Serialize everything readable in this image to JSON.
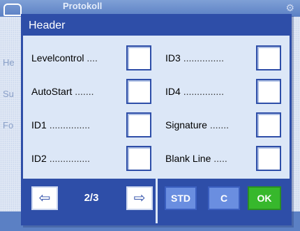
{
  "background": {
    "title": "Protokoll",
    "items": [
      "He",
      "Su",
      "Fo"
    ]
  },
  "dialog": {
    "title": "Header",
    "rows_left": [
      {
        "label": "Levelcontrol",
        "dots": "....",
        "checked": false
      },
      {
        "label": "AutoStart",
        "dots": ".......",
        "checked": false
      },
      {
        "label": "ID1",
        "dots": "...............",
        "checked": false
      },
      {
        "label": "ID2",
        "dots": "...............",
        "checked": false
      }
    ],
    "rows_right": [
      {
        "label": "ID3",
        "dots": "...............",
        "checked": false
      },
      {
        "label": "ID4",
        "dots": "...............",
        "checked": false
      },
      {
        "label": "Signature",
        "dots": ".......",
        "checked": false
      },
      {
        "label": "Blank Line",
        "dots": ".....",
        "checked": false
      }
    ]
  },
  "footer": {
    "prev_icon": "left-arrow-icon",
    "next_icon": "right-arrow-icon",
    "page": "2/3",
    "std_label": "STD",
    "c_label": "C",
    "ok_label": "OK"
  },
  "colors": {
    "dialog_blue": "#2e4ea8",
    "panel": "#dce7f7",
    "ok_green": "#37b82c",
    "button_blue": "#6a8ee0"
  }
}
